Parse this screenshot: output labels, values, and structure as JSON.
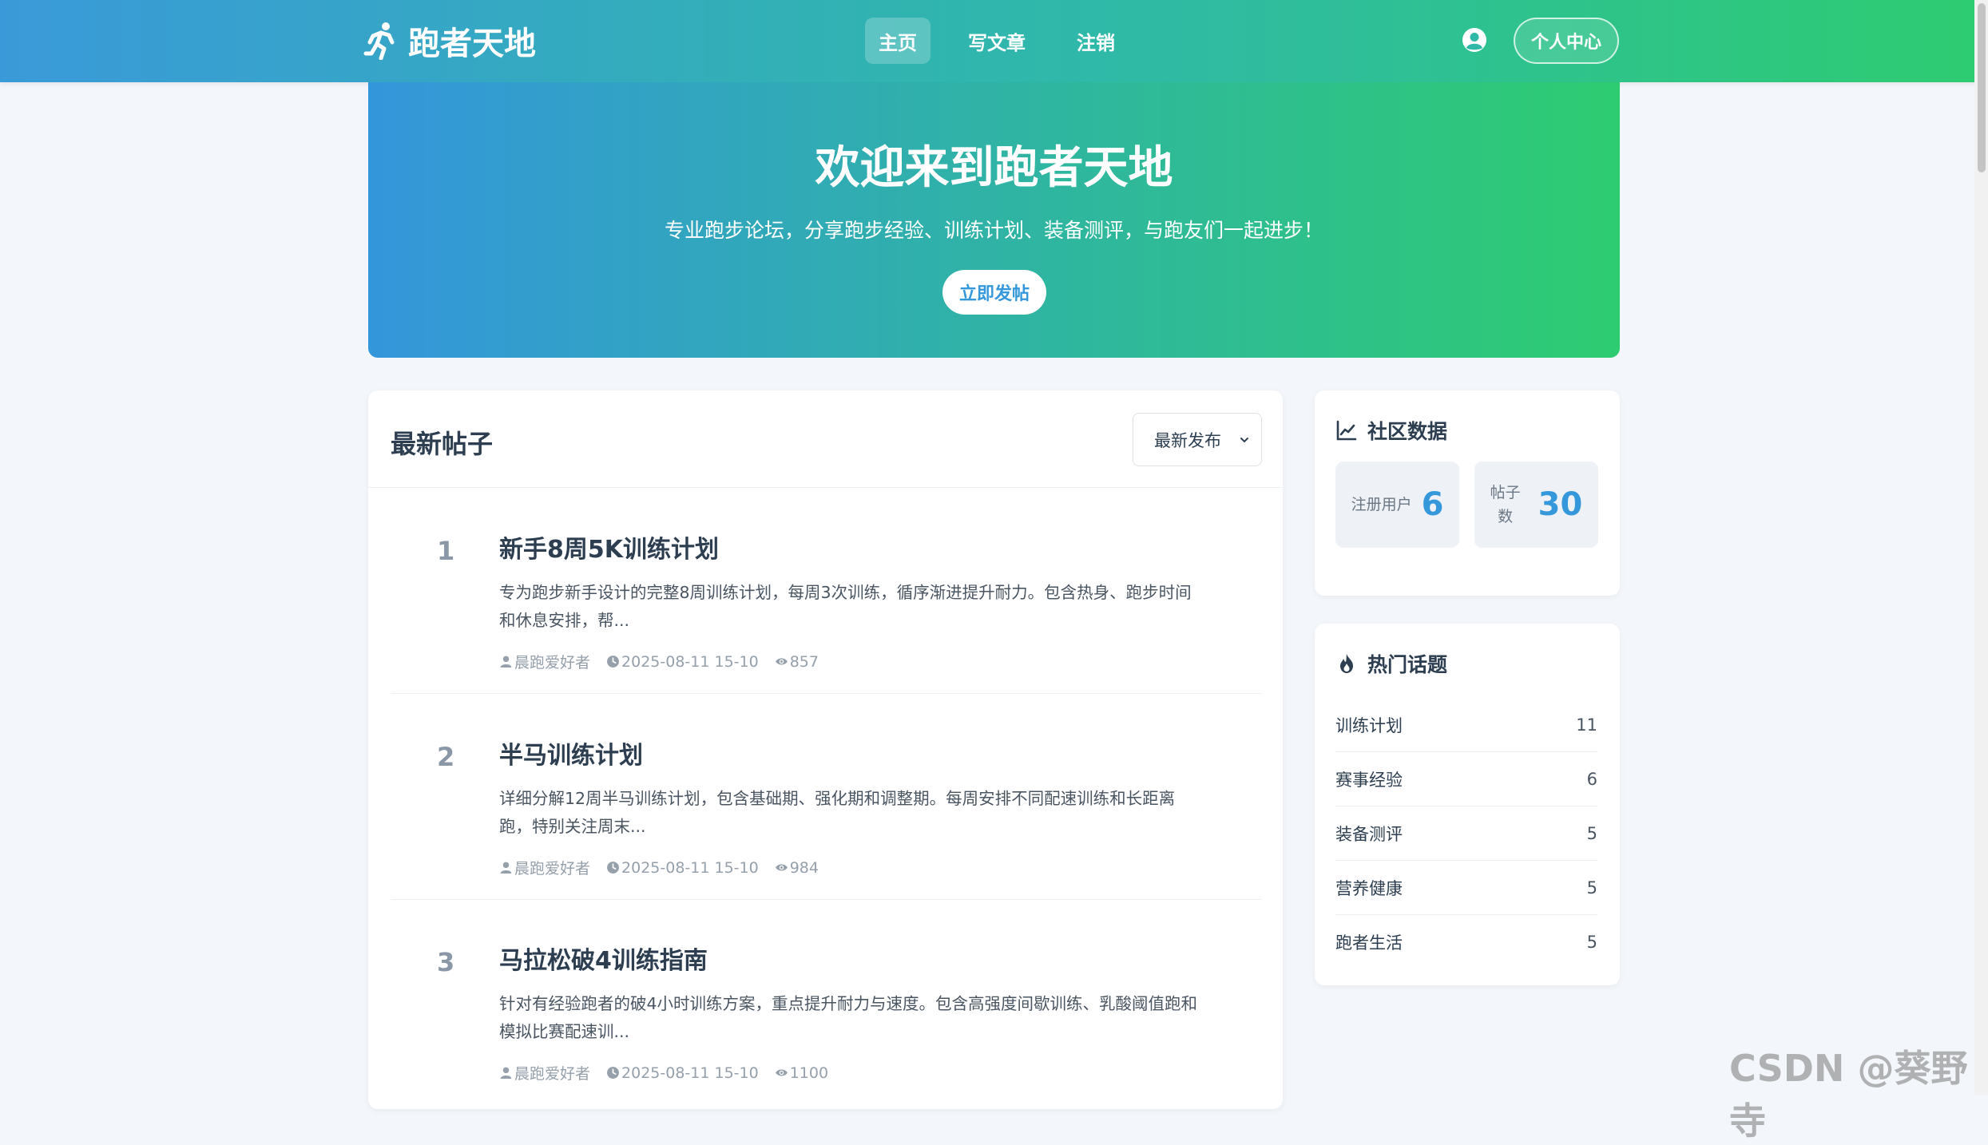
{
  "nav": {
    "brand": "跑者天地",
    "links": [
      "主页",
      "写文章",
      "注销"
    ],
    "active_index": 0,
    "profile_button": "个人中心"
  },
  "hero": {
    "title": "欢迎来到跑者天地",
    "subtitle": "专业跑步论坛，分享跑步经验、训练计划、装备测评，与跑友们一起进步！",
    "button": "立即发帖"
  },
  "posts": {
    "title": "最新帖子",
    "sort_selected": "最新发布",
    "items": [
      {
        "rank": "1",
        "title": "新手8周5K训练计划",
        "excerpt_line1": "专为跑步新手设计的完整8周训练计划，每周3次训练，循序渐进提升耐力。包含热身、跑步时间",
        "excerpt_line2": "和休息安排，帮...",
        "author": "晨跑爱好者",
        "date": "2025-08-11 15-10",
        "views": "857"
      },
      {
        "rank": "2",
        "title": "半马训练计划",
        "excerpt_line1": "详细分解12周半马训练计划，包含基础期、强化期和调整期。每周安排不同配速训练和长距离",
        "excerpt_line2": "跑，特别关注周末...",
        "author": "晨跑爱好者",
        "date": "2025-08-11 15-10",
        "views": "984"
      },
      {
        "rank": "3",
        "title": "马拉松破4训练指南",
        "excerpt_line1": "针对有经验跑者的破4小时训练方案，重点提升耐力与速度。包含高强度间歇训练、乳酸阈值跑和",
        "excerpt_line2": "模拟比赛配速训...",
        "author": "晨跑爱好者",
        "date": "2025-08-11 15-10",
        "views": "1100"
      }
    ]
  },
  "community": {
    "title": "社区数据",
    "users_label": "注册用户",
    "users_value": "6",
    "posts_label_line1": "帖子",
    "posts_label_line2": "数",
    "posts_value": "30"
  },
  "topics": {
    "title": "热门话题",
    "items": [
      {
        "name": "训练计划",
        "count": "11"
      },
      {
        "name": "赛事经验",
        "count": "6"
      },
      {
        "name": "装备测评",
        "count": "5"
      },
      {
        "name": "营养健康",
        "count": "5"
      },
      {
        "name": "跑者生活",
        "count": "5"
      }
    ]
  },
  "watermark": "CSDN @葵野寺",
  "colors": {
    "gradient_start": "#3498db",
    "gradient_end": "#2ecc71",
    "accent": "#3498db"
  }
}
